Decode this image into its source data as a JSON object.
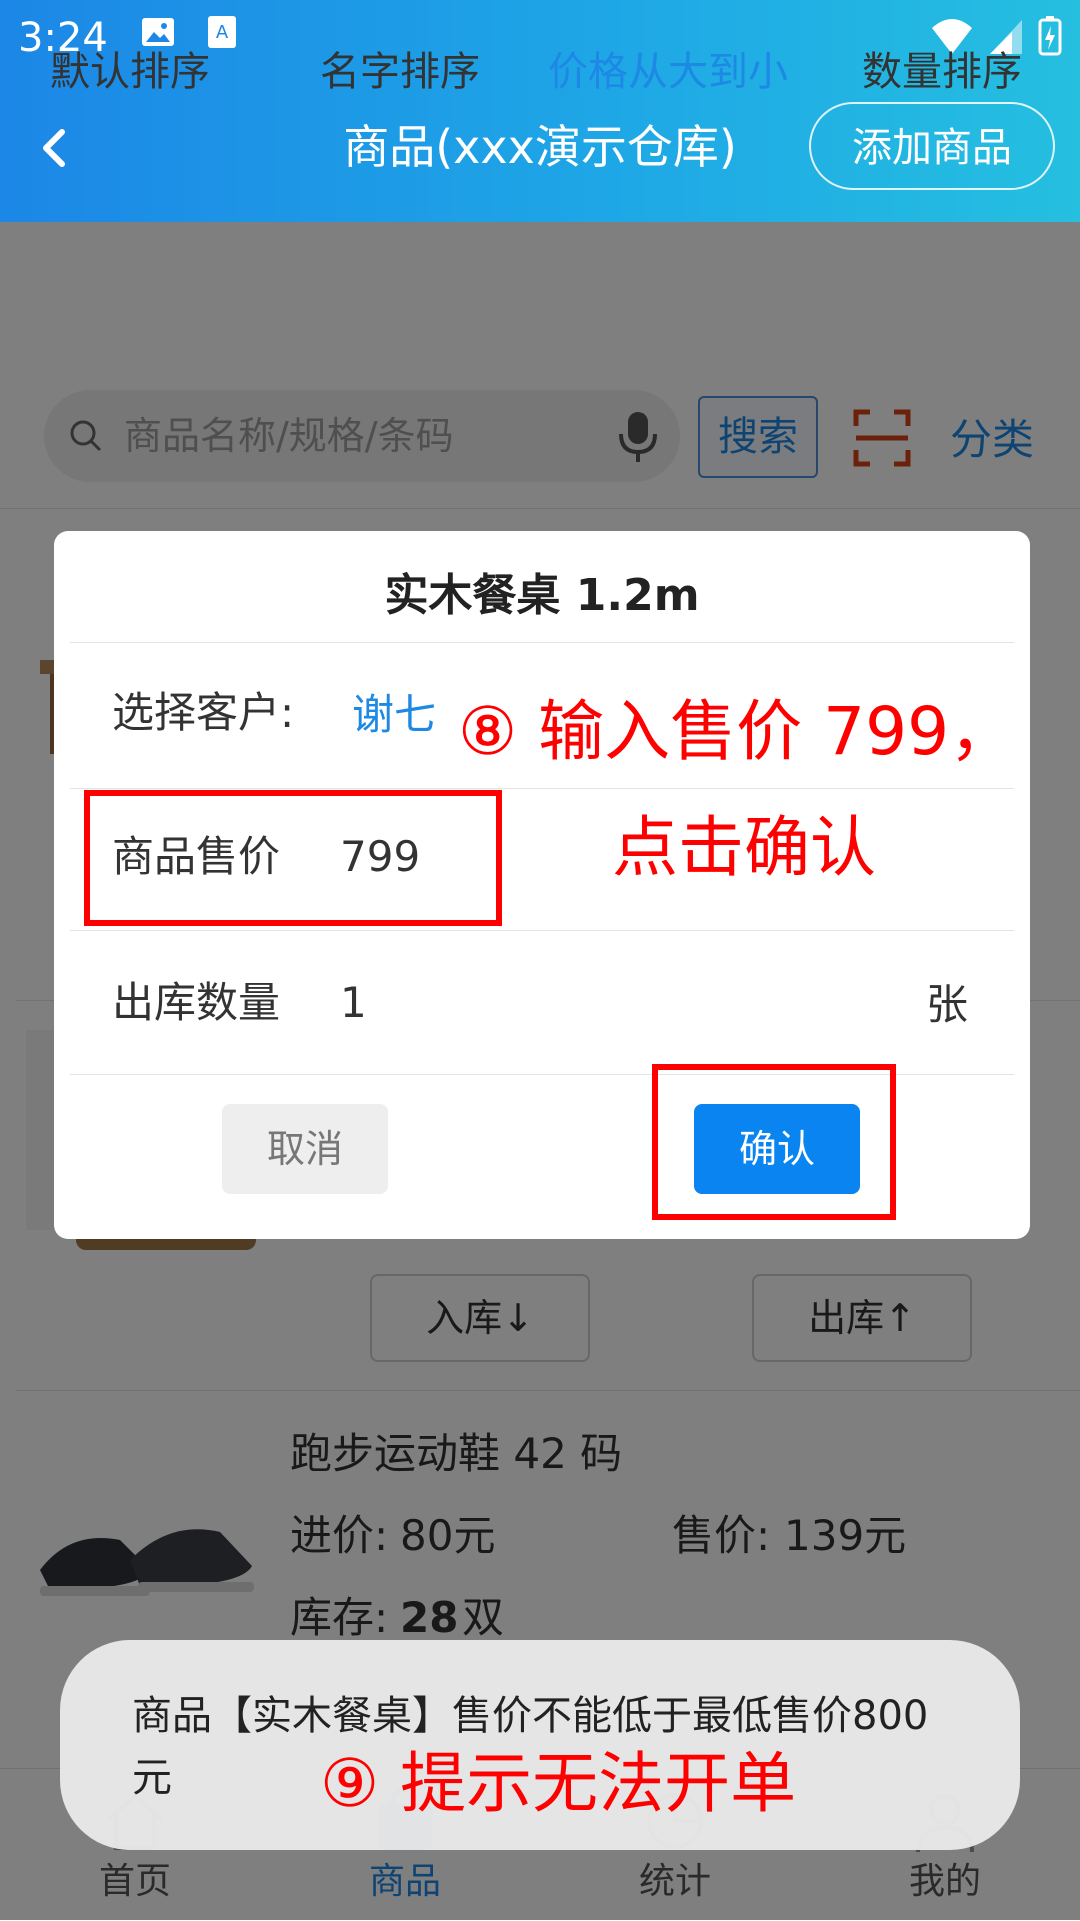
{
  "status_bar": {
    "time": "3:24"
  },
  "header": {
    "title": "商品(xxx演示仓库)",
    "add_button": "添加商品"
  },
  "sort_tabs": [
    {
      "label": "默认排序"
    },
    {
      "label": "名字排序"
    },
    {
      "label": "价格从大到小",
      "active": true
    },
    {
      "label": "数量排序"
    }
  ],
  "search": {
    "placeholder": "商品名称/规格/条码",
    "button": "搜索",
    "category": "分类"
  },
  "list": {
    "stock_in": "入库↓",
    "stock_out": "出库↑",
    "item": {
      "name": "跑步运动鞋  42 码",
      "cost_label": "进价:",
      "cost_value": "80元",
      "price_label": "售价:",
      "price_value": "139元",
      "stock_label": "库存:",
      "stock_value": "28",
      "stock_unit": "双"
    }
  },
  "dialog": {
    "title": "实木餐桌  1.2m",
    "customer_label": "选择客户:",
    "customer_value": "谢七",
    "price_label": "商品售价",
    "price_value": "799",
    "qty_label": "出库数量",
    "qty_value": "1",
    "qty_unit": "张",
    "cancel": "取消",
    "confirm": "确认"
  },
  "annotations": {
    "step8_line1": "⑧ 输入售价 799，",
    "step8_line2": "点击确认",
    "step9": "⑨ 提示无法开单"
  },
  "toast": {
    "message": "商品【实木餐桌】售价不能低于最低售价800元"
  },
  "bottom_nav": [
    {
      "label": "首页",
      "icon": "home-icon"
    },
    {
      "label": "商品",
      "icon": "goods-icon",
      "active": true
    },
    {
      "label": "统计",
      "icon": "stats-icon"
    },
    {
      "label": "我的",
      "icon": "user-icon"
    }
  ],
  "colors": {
    "accent": "#1e88e5",
    "confirm": "#0a84f0",
    "annotation": "#ff0000"
  }
}
